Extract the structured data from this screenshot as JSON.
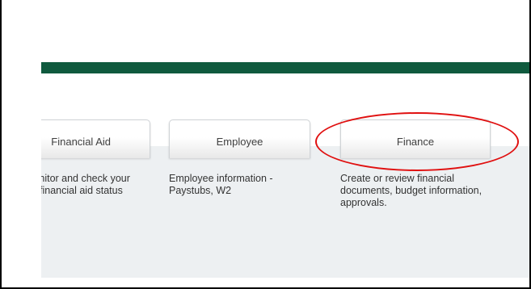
{
  "cards": [
    {
      "id": "financial-aid",
      "label": "Financial Aid",
      "description": "Monitor and check your financial aid status"
    },
    {
      "id": "employee",
      "label": "Employee",
      "description": "Employee information - Paystubs, W2"
    },
    {
      "id": "finance",
      "label": "Finance",
      "description": "Create or review financial documents, budget information, approvals."
    }
  ],
  "colors": {
    "brand_green": "#0f5a3e",
    "panel_gray": "#edf0f2",
    "highlight_red": "#e01010"
  }
}
